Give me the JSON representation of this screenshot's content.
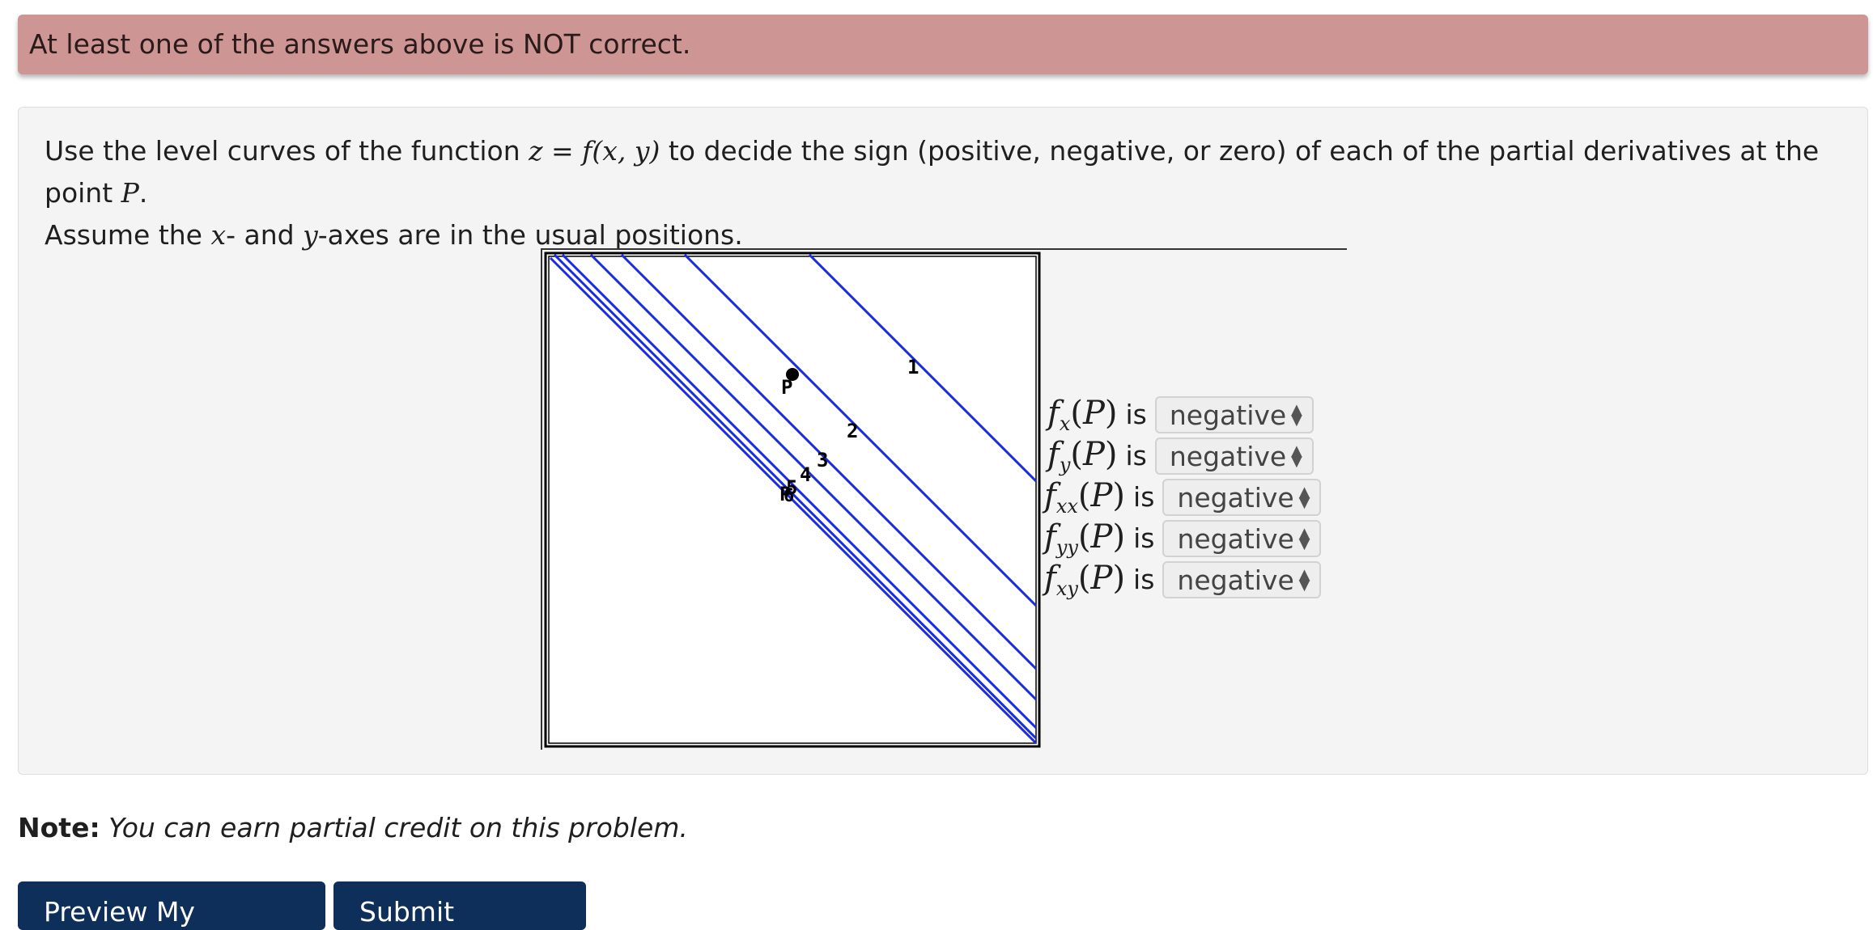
{
  "alert": {
    "text": "At least one of the answers above is NOT correct."
  },
  "problem": {
    "text_1": "Use the level curves of the function ",
    "math_eq": "z = f(x, y)",
    "text_2": " to decide the sign (positive, negative, or zero) of each of the partial derivatives at the point ",
    "math_p": "P",
    "text_3": ".",
    "text_4": "Assume the ",
    "math_x": "x",
    "text_5": "- and ",
    "math_y": "y",
    "text_6": "-axes are in the usual positions."
  },
  "figure": {
    "curve_labels": [
      "1",
      "2",
      "3",
      "4",
      "5",
      "6"
    ],
    "point_label": "P",
    "point_label_duplicate": "P",
    "curve_color": "#1a2be8"
  },
  "answers": [
    {
      "subscript": "x",
      "is_text": "is",
      "value": "negative"
    },
    {
      "subscript": "y",
      "is_text": "is",
      "value": "negative"
    },
    {
      "subscript": "xx",
      "is_text": "is",
      "value": "negative"
    },
    {
      "subscript": "yy",
      "is_text": "is",
      "value": "negative"
    },
    {
      "subscript": "xy",
      "is_text": "is",
      "value": "negative"
    }
  ],
  "answer_math": {
    "fn": "f",
    "open": "(",
    "point": "P",
    "close": ")"
  },
  "note": {
    "bold": "Note:",
    "text": "You can earn partial credit on this problem."
  },
  "buttons": {
    "preview": "Preview My Answers",
    "submit": "Submit Answers"
  }
}
